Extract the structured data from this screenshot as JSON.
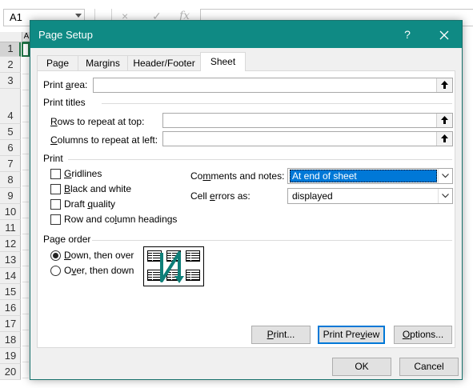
{
  "excel": {
    "name_box": "A1",
    "formula_icons": {
      "cancel": "×",
      "enter": "✓",
      "fx": "fx"
    },
    "column_header": "A",
    "rows": [
      "1",
      "2",
      "3",
      "4",
      "5",
      "6",
      "7",
      "8",
      "9",
      "10",
      "11",
      "12",
      "13",
      "14",
      "15",
      "16",
      "17",
      "18",
      "19",
      "20"
    ]
  },
  "dialog": {
    "title": "Page Setup",
    "help_label": "?",
    "tabs": [
      {
        "label": "Page"
      },
      {
        "label": "Margins"
      },
      {
        "label": "Header/Footer"
      },
      {
        "label": "Sheet",
        "active": true
      }
    ],
    "print_area": {
      "label_pre": "Print ",
      "label_key": "a",
      "label_post": "rea:",
      "value": ""
    },
    "print_titles": {
      "heading": "Print titles",
      "rows_label_key": "R",
      "rows_label_rest": "ows to repeat at top:",
      "rows_value": "",
      "cols_label_key": "C",
      "cols_label_rest": "olumns to repeat at left:",
      "cols_value": ""
    },
    "print": {
      "heading": "Print",
      "checkboxes": [
        {
          "key": "G",
          "rest": "ridlines",
          "checked": false
        },
        {
          "key": "B",
          "rest": "lack and white",
          "checked": false
        },
        {
          "pre": "Draft ",
          "key": "q",
          "rest": "uality",
          "checked": false
        },
        {
          "pre": "Row and co",
          "key": "l",
          "rest": "umn headings",
          "checked": false
        }
      ],
      "comments_label_pre": "Co",
      "comments_label_key": "m",
      "comments_label_rest": "ments and notes:",
      "comments_value": "At end of sheet",
      "errors_label_pre": "Cell ",
      "errors_label_key": "e",
      "errors_label_rest": "rrors as:",
      "errors_value": "displayed"
    },
    "page_order": {
      "heading": "Page order",
      "options": [
        {
          "key": "D",
          "rest": "own, then over",
          "selected": true
        },
        {
          "pre": "O",
          "key": "v",
          "rest": "er, then down",
          "selected": false
        }
      ]
    },
    "buttons": {
      "print": {
        "key": "P",
        "rest": "rint..."
      },
      "preview": {
        "pre": "Print Pre",
        "key": "v",
        "rest": "iew"
      },
      "options": {
        "key": "O",
        "rest": "ptions..."
      },
      "ok": "OK",
      "cancel": "Cancel"
    },
    "colors": {
      "titlebar": "#0f8a84",
      "selection": "#0078d7"
    }
  }
}
